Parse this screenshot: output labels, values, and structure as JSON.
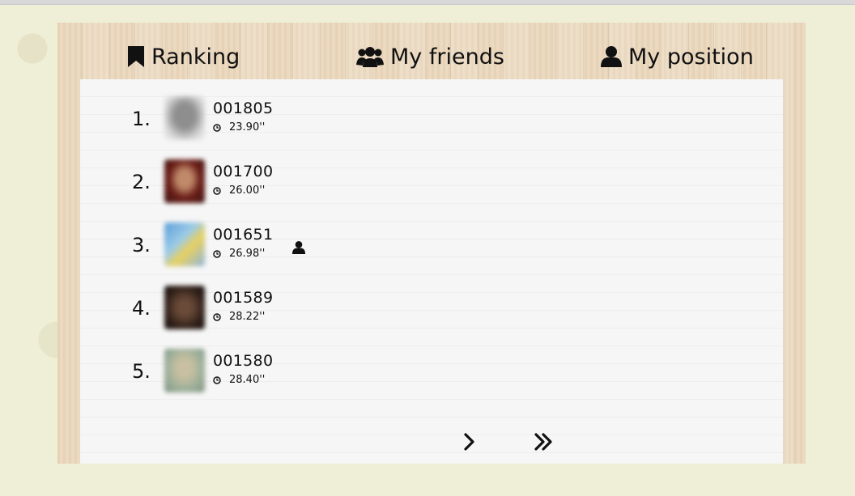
{
  "tabs": [
    {
      "label": "Ranking",
      "icon": "bookmark-icon"
    },
    {
      "label": "My friends",
      "icon": "users-icon"
    },
    {
      "label": "My position",
      "icon": "user-icon"
    }
  ],
  "ranking": [
    {
      "rank": "1.",
      "score": "001805",
      "time": "23.90''",
      "name": "",
      "avatar_color": "#b9b9b9"
    },
    {
      "rank": "2.",
      "score": "001700",
      "time": "26.00''",
      "name": "",
      "avatar_color": "#7a2a1e"
    },
    {
      "rank": "3.",
      "score": "001651",
      "time": "26.98''",
      "name": "",
      "avatar_color": "#6aa6d8",
      "current_user": true
    },
    {
      "rank": "4.",
      "score": "001589",
      "time": "28.22''",
      "name": "",
      "avatar_color": "#3a2a22"
    },
    {
      "rank": "5.",
      "score": "001580",
      "time": "28.40''",
      "name": "",
      "avatar_color": "#9fb09a"
    }
  ],
  "pagination": {
    "next_icon": "chevron-right-icon",
    "last_icon": "double-chevron-right-icon"
  },
  "colors": {
    "background": "#efeed6",
    "wood": "#ead7bc",
    "panel": "#f6f6f6",
    "text": "#111111"
  }
}
